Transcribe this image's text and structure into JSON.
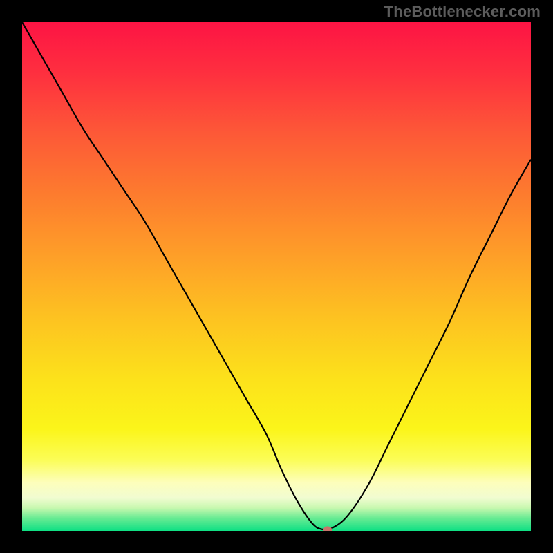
{
  "watermark": "TheBottlenecker.com",
  "colors": {
    "frame_bg": "#000000",
    "curve_stroke": "#000000",
    "marker_fill": "#c9746b",
    "gradient_stops": [
      {
        "offset": 0.0,
        "color": "#fd1444"
      },
      {
        "offset": 0.1,
        "color": "#fe2f3f"
      },
      {
        "offset": 0.22,
        "color": "#fd5937"
      },
      {
        "offset": 0.34,
        "color": "#fd7c2e"
      },
      {
        "offset": 0.46,
        "color": "#fe9f28"
      },
      {
        "offset": 0.58,
        "color": "#fdc221"
      },
      {
        "offset": 0.7,
        "color": "#fce11b"
      },
      {
        "offset": 0.8,
        "color": "#fbf51a"
      },
      {
        "offset": 0.86,
        "color": "#fbfd56"
      },
      {
        "offset": 0.905,
        "color": "#fdfebb"
      },
      {
        "offset": 0.935,
        "color": "#f1fcd1"
      },
      {
        "offset": 0.955,
        "color": "#c7f8af"
      },
      {
        "offset": 0.975,
        "color": "#68eb93"
      },
      {
        "offset": 1.0,
        "color": "#0fe084"
      }
    ]
  },
  "chart_data": {
    "type": "line",
    "title": "",
    "xlabel": "",
    "ylabel": "",
    "xlim": [
      0,
      100
    ],
    "ylim": [
      0,
      100
    ],
    "x": [
      0,
      4,
      8,
      12,
      16,
      20,
      24,
      28,
      32,
      36,
      40,
      44,
      48,
      51,
      54,
      57,
      59,
      61,
      64,
      68,
      72,
      76,
      80,
      84,
      88,
      92,
      96,
      100
    ],
    "y": [
      100,
      93,
      86,
      79,
      73,
      67,
      61,
      54,
      47,
      40,
      33,
      26,
      19,
      12,
      6,
      1.5,
      0.3,
      0.6,
      3,
      9,
      17,
      25,
      33,
      41,
      50,
      58,
      66,
      73
    ],
    "marker": {
      "x": 60,
      "y": 0.2
    }
  }
}
